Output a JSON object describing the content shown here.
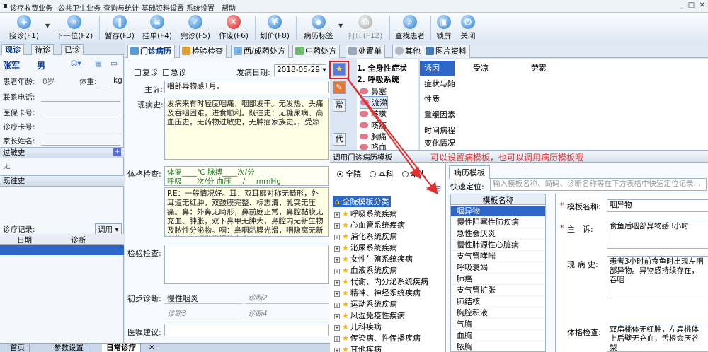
{
  "menu": [
    "诊疗收费业务",
    "公共卫生业务",
    "查询与统计",
    "基础资料设置",
    "系统设置",
    "帮助"
  ],
  "toolbar": {
    "receive": "接诊(F1)",
    "next": "下一位(F2)",
    "hold": "暂存(F3)",
    "register": "挂单(F4)",
    "finish": "完诊(F5)",
    "void": "作废(F6)",
    "price": "划价(F8)",
    "record_tag": "病历标签",
    "print": "打印(F12)",
    "find_patient": "查找患者",
    "lock": "锁屏",
    "close": "关闭"
  },
  "left": {
    "tabs": [
      "现诊",
      "待诊",
      "已诊"
    ],
    "patient_name": "张军",
    "gender": "男",
    "age_label": "患者年龄:",
    "age_value": "0岁",
    "weight_label": "体重:",
    "weight_unit": "kg",
    "contact_label": "联系电话:",
    "insurance_label": "医保卡号:",
    "clinic_card_label": "诊疗卡号:",
    "parent_label": "家长姓名:",
    "allergy_label": "过敏史",
    "allergy_value": "无",
    "history_label": "既往史",
    "records_label": "诊疗记录:",
    "call_label": "调用",
    "col_date": "日期",
    "col_diag": "诊断"
  },
  "bottom_tabs": [
    "首页",
    "参数设置",
    "日常诊疗"
  ],
  "main_tabs": [
    "门诊病历",
    "检验检查",
    "西/成药处方",
    "中药处方",
    "处置单",
    "其他",
    "图片资料"
  ],
  "form": {
    "revisit": "复诊",
    "emergency": "急诊",
    "onset_label": "发病日期:",
    "onset_date": "2018-05-29",
    "complaint_label": "主诉:",
    "complaint_value": "咽部异物感1月。",
    "present_label": "现病史:",
    "present_value": "发病来有时轻度咽痛，咽部发干。无发热、头痛及吞咽困难，进食顺利。既往史：无糖尿病、高血压史，无药物过敏史，无肿瘤家族史。，受凉",
    "exam_label": "体格检查:",
    "vitals_line1": "体温____℃    脉搏____次/分",
    "vitals_line2": "呼吸____次/分  血压___/___mmHg",
    "exam_value": "P.E：一般情况好。耳：双耳廓对称无畸形，外耳道无红肿，双鼓膜完整、标志清，乳突无压痛。鼻：外鼻无畸形，鼻前庭正常，鼻腔黏膜无充血、肿胀，双下鼻甲无肿大，鼻腔内无新生物及脓性分泌物。咽：鼻咽黏膜光滑，咽隐窝无新生物。口咽黏膜慢性充血",
    "lab_label": "检验检查:",
    "diag_label": "初步诊断:",
    "diag1": "慢性咽炎",
    "diag2": "诊断2",
    "diag3": "诊断3",
    "diag4": "诊断4",
    "advice_label": "医嘱建议:",
    "side_btn_common": "常",
    "side_btn_replace": "代"
  },
  "symptoms": {
    "sec1": "1. 全身性症状",
    "sec2": "2. 呼吸系统",
    "items": [
      "鼻塞",
      "流涕",
      "咳嗽",
      "咳痰",
      "胸痛",
      "咯血"
    ]
  },
  "symptom_categories": [
    "诱因",
    "症状与随伴",
    "性质",
    "重缓因素",
    "时间病程",
    "变化情况"
  ],
  "symptom_details": [
    "受凉",
    "劳累"
  ],
  "template_window": {
    "title": "调用门诊病历模板",
    "scope_all": "全院",
    "scope_dept": "本科",
    "scope_self": "本人",
    "tree_root": "全院模板分类",
    "tree": [
      "呼吸系统疾病",
      "心血管系统疾病",
      "消化系统疾病",
      "泌尿系统疾病",
      "女性生殖系统疾病",
      "血液系统疾病",
      "代谢、内分泌系统疾病",
      "精神、神经系统疾病",
      "运动系统疾病",
      "风湿免疫性疾病",
      "儿科疾病",
      "传染病、性传播疾病",
      "其他疾病"
    ],
    "panel_tab": "病历模板",
    "quick_label": "快速定位:",
    "quick_placeholder": "输入模板名称、简码、诊断名称等在下方表格中快速定位记录...",
    "col_name": "模板名称",
    "list": [
      "咽异物",
      "慢性阻塞性肺疾病",
      "急性会厌炎",
      "慢性肺源性心脏病",
      "支气管哮喘",
      "呼吸衰竭",
      "肺癌",
      "支气管扩张",
      "肺结核",
      "胸腔积液",
      "气胸",
      "血胸",
      "脓胸"
    ],
    "name_label": "模板名称:",
    "name_value": "咽异物",
    "complaint_label": "主　诉:",
    "complaint_value": "食鱼后咽部异物感3小时",
    "present_label": "现 病 史:",
    "present_value": "患者3小时前食鱼时出现左咽部异物。异物感持续存在，吞咽",
    "exam_label": "体格检查:",
    "exam_value": "双扁桃体无红肿，左扁桃体上后壁无充血，舌根会厌谷梨"
  },
  "annotation": "可以设置病模板，也可以调用病历模板哦"
}
